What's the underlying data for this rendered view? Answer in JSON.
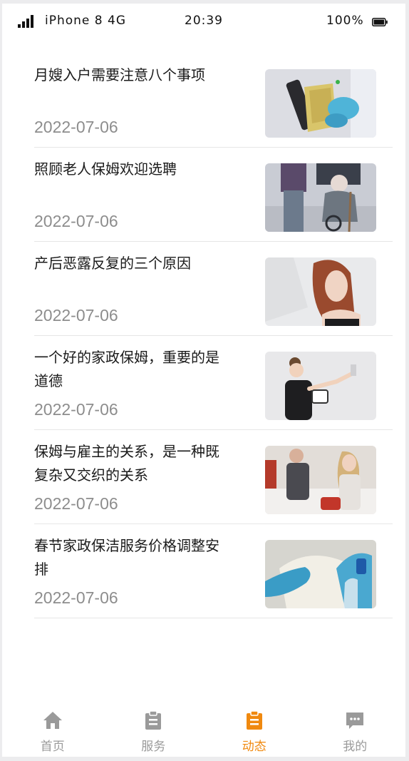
{
  "status_bar": {
    "carrier": "iPhone 8  4G",
    "time": "20:39",
    "battery": "100%"
  },
  "news": [
    {
      "title": "月嫂入户需要注意八个事项",
      "date": "2022-07-06",
      "thumb": "cleaning-gloves"
    },
    {
      "title": "照顾老人保姆欢迎选聘",
      "date": "2022-07-06",
      "thumb": "elderly-wheelchair"
    },
    {
      "title": "产后恶露反复的三个原因",
      "date": "2022-07-06",
      "thumb": "woman-portrait"
    },
    {
      "title": "一个好的家政保姆，重要的是道德",
      "date": "2022-07-06",
      "thumb": "woman-painting-wall"
    },
    {
      "title": "保姆与雇主的关系，是一种既复杂又交织的关系",
      "date": "2022-07-06",
      "thumb": "couple-cooking"
    },
    {
      "title": "春节家政保洁服务价格调整安排",
      "date": "2022-07-06",
      "thumb": "glove-wiping"
    }
  ],
  "tabs": [
    {
      "label": "首页",
      "icon": "home-icon",
      "active": false
    },
    {
      "label": "服务",
      "icon": "clipboard-icon",
      "active": false
    },
    {
      "label": "动态",
      "icon": "clipboard-icon",
      "active": true
    },
    {
      "label": "我的",
      "icon": "chat-icon",
      "active": false
    }
  ],
  "colors": {
    "active_tab": "#f0890f",
    "inactive_tab": "#9a9a9a",
    "title_text": "#1a1a1a",
    "date_text": "#8d8d8d"
  }
}
